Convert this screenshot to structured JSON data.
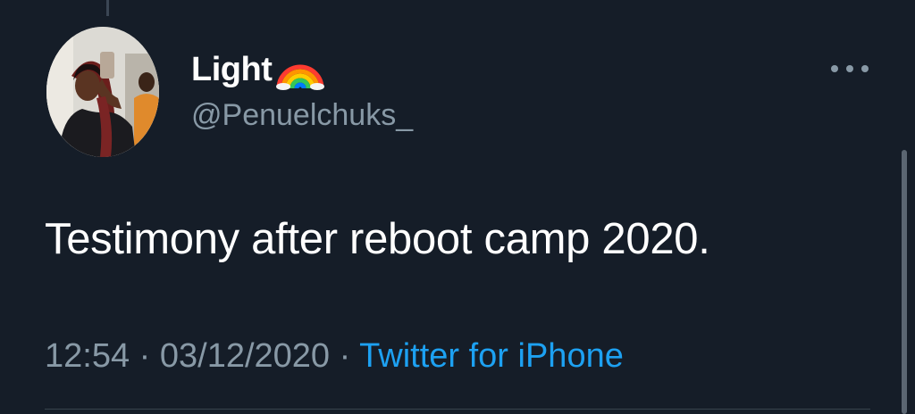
{
  "tweet": {
    "display_name": "Light",
    "name_emoji_icon": "rainbow-icon",
    "handle": "@Penuelchuks_",
    "text": "Testimony after reboot camp 2020.",
    "time": "12:54",
    "separator": "·",
    "date": "03/12/2020",
    "source": "Twitter for iPhone"
  },
  "icons": {
    "more": "more-options-icon",
    "avatar": "profile-avatar"
  },
  "colors": {
    "background": "#151d28",
    "primary_text": "#ffffff",
    "secondary_text": "#8899a6",
    "link": "#1da1f2"
  }
}
